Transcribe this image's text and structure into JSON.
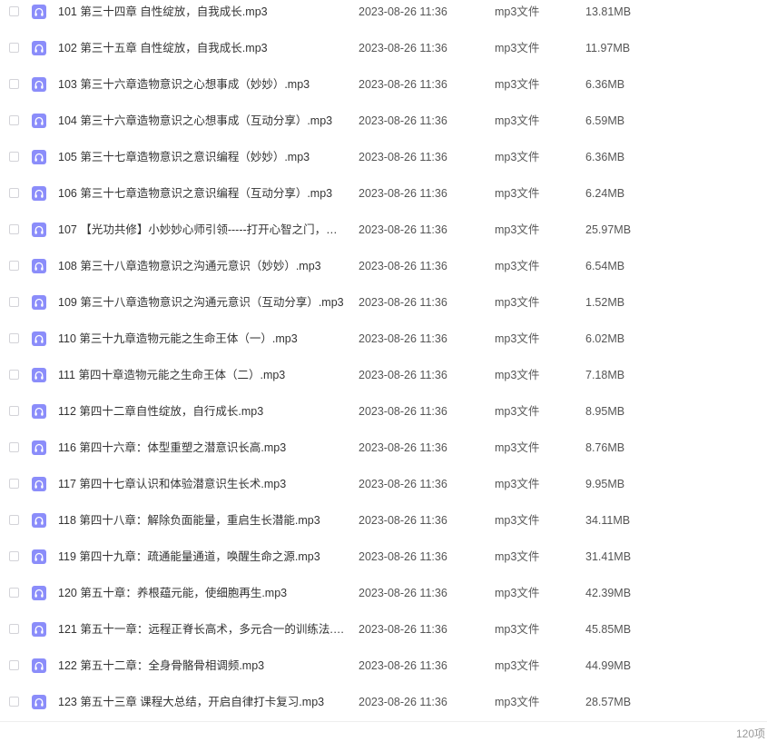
{
  "colors": {
    "icon_bg": "#8b8dfa",
    "text": "#333333",
    "secondary_text": "#555555",
    "muted_text": "#999999"
  },
  "file_icon": "headphones-audio-icon",
  "files": [
    {
      "name": "101 第三十四章 自性绽放，自我成长.mp3",
      "date": "2023-08-26 11:36",
      "type": "mp3文件",
      "size": "13.81MB"
    },
    {
      "name": "102 第三十五章 自性绽放，自我成长.mp3",
      "date": "2023-08-26 11:36",
      "type": "mp3文件",
      "size": "11.97MB"
    },
    {
      "name": "103 第三十六章造物意识之心想事成（妙妙）.mp3",
      "date": "2023-08-26 11:36",
      "type": "mp3文件",
      "size": "6.36MB"
    },
    {
      "name": "104 第三十六章造物意识之心想事成（互动分享）.mp3",
      "date": "2023-08-26 11:36",
      "type": "mp3文件",
      "size": "6.59MB"
    },
    {
      "name": "105 第三十七章造物意识之意识编程（妙妙）.mp3",
      "date": "2023-08-26 11:36",
      "type": "mp3文件",
      "size": "6.36MB"
    },
    {
      "name": "106 第三十七章造物意识之意识编程（互动分享）.mp3",
      "date": "2023-08-26 11:36",
      "type": "mp3文件",
      "size": "6.24MB"
    },
    {
      "name": "107 【光功共修】小妙妙心师引领-----打开心智之门，彰…",
      "date": "2023-08-26 11:36",
      "type": "mp3文件",
      "size": "25.97MB"
    },
    {
      "name": "108 第三十八章造物意识之沟通元意识（妙妙）.mp3",
      "date": "2023-08-26 11:36",
      "type": "mp3文件",
      "size": "6.54MB"
    },
    {
      "name": "109 第三十八章造物意识之沟通元意识（互动分享）.mp3",
      "date": "2023-08-26 11:36",
      "type": "mp3文件",
      "size": "1.52MB"
    },
    {
      "name": "110 第三十九章造物元能之生命王体（一）.mp3",
      "date": "2023-08-26 11:36",
      "type": "mp3文件",
      "size": "6.02MB"
    },
    {
      "name": "111 第四十章造物元能之生命王体（二）.mp3",
      "date": "2023-08-26 11:36",
      "type": "mp3文件",
      "size": "7.18MB"
    },
    {
      "name": "112 第四十二章自性绽放，自行成长.mp3",
      "date": "2023-08-26 11:36",
      "type": "mp3文件",
      "size": "8.95MB"
    },
    {
      "name": "116 第四十六章：体型重塑之潜意识长高.mp3",
      "date": "2023-08-26 11:36",
      "type": "mp3文件",
      "size": "8.76MB"
    },
    {
      "name": "117 第四十七章认识和体验潜意识生长术.mp3",
      "date": "2023-08-26 11:36",
      "type": "mp3文件",
      "size": "9.95MB"
    },
    {
      "name": "118 第四十八章：解除负面能量，重启生长潜能.mp3",
      "date": "2023-08-26 11:36",
      "type": "mp3文件",
      "size": "34.11MB"
    },
    {
      "name": "119 第四十九章：疏通能量通道，唤醒生命之源.mp3",
      "date": "2023-08-26 11:36",
      "type": "mp3文件",
      "size": "31.41MB"
    },
    {
      "name": "120 第五十章：养根蕴元能，使细胞再生.mp3",
      "date": "2023-08-26 11:36",
      "type": "mp3文件",
      "size": "42.39MB"
    },
    {
      "name": "121 第五十一章：远程正脊长高术，多元合一的训练法.m…",
      "date": "2023-08-26 11:36",
      "type": "mp3文件",
      "size": "45.85MB"
    },
    {
      "name": "122 第五十二章：全身骨骼骨相调频.mp3",
      "date": "2023-08-26 11:36",
      "type": "mp3文件",
      "size": "44.99MB"
    },
    {
      "name": "123 第五十三章 课程大总结，开启自律打卡复习.mp3",
      "date": "2023-08-26 11:36",
      "type": "mp3文件",
      "size": "28.57MB"
    }
  ],
  "footer": {
    "total": "120项"
  }
}
